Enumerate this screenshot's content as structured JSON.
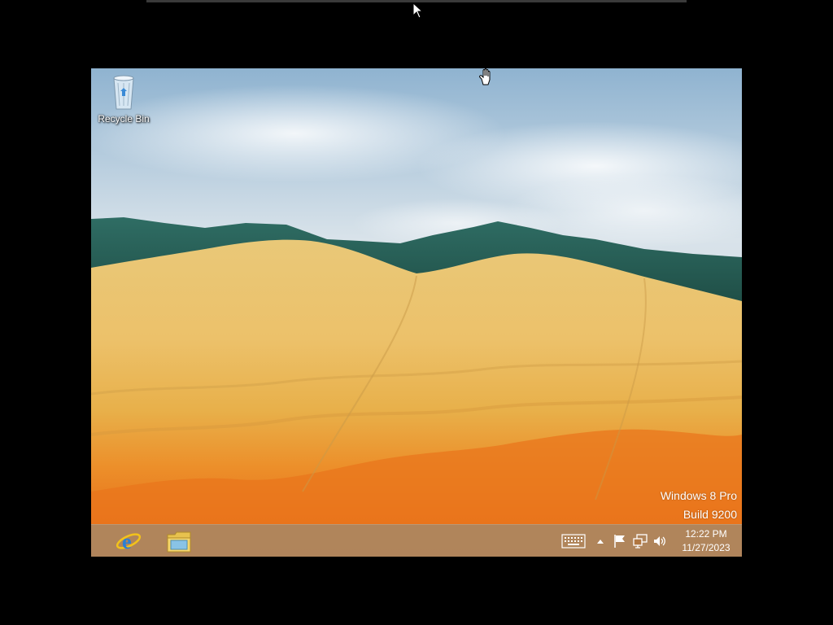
{
  "desktop": {
    "icons": [
      {
        "label": "Recycle Bin",
        "icon": "recycle-bin-icon"
      }
    ],
    "watermark": {
      "line1": "Windows 8 Pro",
      "line2": "Build 9200"
    }
  },
  "taskbar": {
    "pinned": [
      {
        "name": "Internet Explorer",
        "icon": "internet-explorer-icon"
      },
      {
        "name": "File Explorer",
        "icon": "file-explorer-icon"
      }
    ],
    "tray": [
      {
        "icon": "touch-keyboard-icon"
      },
      {
        "icon": "show-hidden-icons-icon"
      },
      {
        "icon": "action-center-flag-icon"
      },
      {
        "icon": "network-icon"
      },
      {
        "icon": "volume-icon"
      }
    ],
    "clock": {
      "time": "12:22 PM",
      "date": "11/27/2023"
    }
  },
  "colors": {
    "taskbar": "#b07640",
    "sky": "#a7bfd3",
    "hill": "#e6b04a",
    "hill_stripe": "#e8741d"
  }
}
